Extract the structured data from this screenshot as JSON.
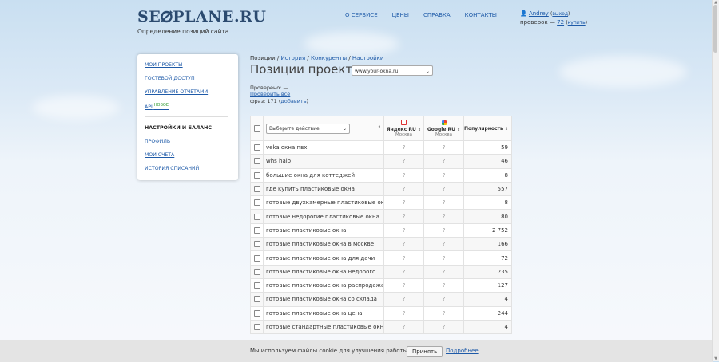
{
  "logo": {
    "text_left": "SE",
    "text_right": "PLANE.RU"
  },
  "tagline": "Определение позиций сайта",
  "nav": [
    "О СЕРВИСЕ",
    "ЦЕНЫ",
    "СПРАВКА",
    "КОНТАКТЫ"
  ],
  "user": {
    "name": "Andrey",
    "logout": "выход",
    "checks_label": "проверок —",
    "checks_count": "72",
    "buy": "купить"
  },
  "sidebar": {
    "links": [
      "МОИ ПРОЕКТЫ",
      "ГОСТЕВОЙ ДОСТУП",
      "УПРАВЛЕНИЕ ОТЧЁТАМИ",
      "API"
    ],
    "api_badge": "новое",
    "section_title": "НАСТРОЙКИ И БАЛАНС",
    "settings_links": [
      "ПРОФИЛЬ",
      "МОИ СЧЕТА",
      "ИСТОРИЯ СПИСАНИЙ"
    ]
  },
  "breadcrumb": {
    "first": "Позиции",
    "items": [
      "История",
      "Конкуренты",
      "Настройки"
    ]
  },
  "page_title": "Позиции проекта:",
  "site_select": "www.your-okna.ru",
  "meta": {
    "checked_label": "Проверено:",
    "checked_value": "—",
    "check_all": "Проверить все",
    "phrases_label": "фраз: 171",
    "add": "добавить"
  },
  "table": {
    "action_placeholder": "Выберите действие",
    "yandex": {
      "name": "Яндекс RU",
      "region": "Москва"
    },
    "google": {
      "name": "Google RU",
      "region": "Москва"
    },
    "popularity": "Популярность",
    "rows": [
      {
        "phrase": "veka окна пвх",
        "ya": "?",
        "go": "?",
        "pop": "59"
      },
      {
        "phrase": "whs halo",
        "ya": "?",
        "go": "?",
        "pop": "46"
      },
      {
        "phrase": "большие окна для коттеджей",
        "ya": "?",
        "go": "?",
        "pop": "8"
      },
      {
        "phrase": "где купить пластиковые окна",
        "ya": "?",
        "go": "?",
        "pop": "557"
      },
      {
        "phrase": "готовые двухкамерные пластиковые окна",
        "ya": "?",
        "go": "?",
        "pop": "8"
      },
      {
        "phrase": "готовые недорогие пластиковые окна",
        "ya": "?",
        "go": "?",
        "pop": "80"
      },
      {
        "phrase": "готовые пластиковые окна",
        "ya": "?",
        "go": "?",
        "pop": "2 752"
      },
      {
        "phrase": "готовые пластиковые окна в москве",
        "ya": "?",
        "go": "?",
        "pop": "166"
      },
      {
        "phrase": "готовые пластиковые окна для дачи",
        "ya": "?",
        "go": "?",
        "pop": "72"
      },
      {
        "phrase": "готовые пластиковые окна недорого",
        "ya": "?",
        "go": "?",
        "pop": "235"
      },
      {
        "phrase": "готовые пластиковые окна распродажа",
        "ya": "?",
        "go": "?",
        "pop": "127"
      },
      {
        "phrase": "готовые пластиковые окна со склада",
        "ya": "?",
        "go": "?",
        "pop": "4"
      },
      {
        "phrase": "готовые пластиковые окна цена",
        "ya": "?",
        "go": "?",
        "pop": "244"
      },
      {
        "phrase": "готовые стандартные пластиковые окна",
        "ya": "?",
        "go": "?",
        "pop": "4"
      }
    ]
  },
  "cookie": {
    "text": "Мы используем файлы cookie для улучшения работы сайта.",
    "accept": "Принять",
    "more": "Подробнее"
  },
  "colors": {
    "link": "#1e5aa8",
    "logo": "#2b4a6f",
    "badge": "#2e9a2e"
  }
}
